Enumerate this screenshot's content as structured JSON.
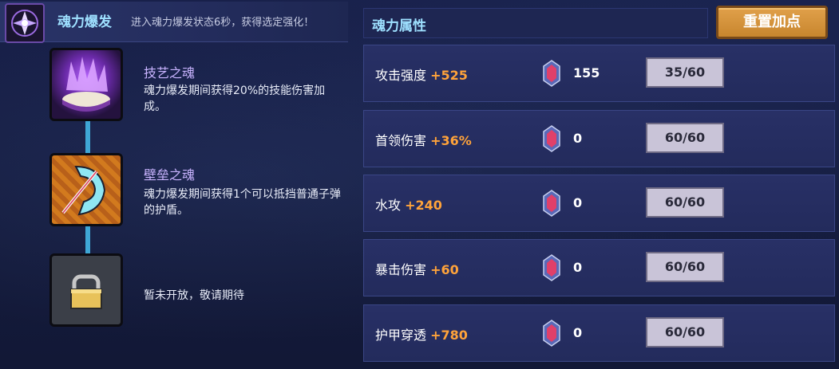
{
  "burst": {
    "title": "魂力爆发",
    "description": "进入魂力爆发状态6秒，获得选定强化！"
  },
  "skills": [
    {
      "name": "技艺之魂",
      "description": "魂力爆发期间获得20%的技能伤害加成。"
    },
    {
      "name": "壁垒之魂",
      "description": "魂力爆发期间获得1个可以抵挡普通子弹的护盾。"
    }
  ],
  "locked": {
    "text": "暂未开放，敬请期待"
  },
  "attributes_panel": {
    "title": "魂力属性",
    "reset_label": "重置加点"
  },
  "attributes": [
    {
      "name": "攻击强度",
      "bonus": "+525",
      "cost": "155",
      "level": "35/60"
    },
    {
      "name": "首领伤害",
      "bonus": "+36%",
      "cost": "0",
      "level": "60/60"
    },
    {
      "name": "水攻",
      "bonus": "+240",
      "cost": "0",
      "level": "60/60"
    },
    {
      "name": "暴击伤害",
      "bonus": "+60",
      "cost": "0",
      "level": "60/60"
    },
    {
      "name": "护甲穿透",
      "bonus": "+780",
      "cost": "0",
      "level": "60/60"
    }
  ],
  "colors": {
    "accent_title": "#9ee0ff",
    "bonus": "#ffa33a",
    "button": "#d8963e"
  },
  "icons": [
    "soul-burst-icon",
    "skill-soul-icon",
    "bulwark-soul-icon",
    "lock-icon",
    "soul-gem-icon"
  ]
}
